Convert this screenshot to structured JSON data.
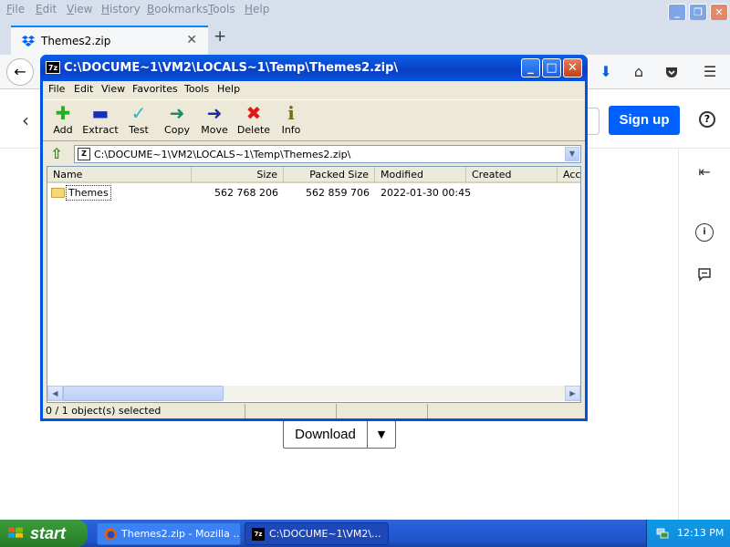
{
  "firefox": {
    "menu": [
      "File",
      "Edit",
      "View",
      "History",
      "Bookmarks",
      "Tools",
      "Help"
    ],
    "menu_accel": [
      "F",
      "E",
      "V",
      "H",
      "B",
      "T",
      "H"
    ],
    "menu_rest": [
      "ile",
      "dit",
      "iew",
      "istory",
      "ookmarks",
      "ools",
      "elp"
    ],
    "tab_title": "Themes2.zip",
    "tab_close": "✕",
    "new_tab": "+"
  },
  "dropbox": {
    "signup_label": "Sign up",
    "download_label": "Download",
    "accent": "#0061fe"
  },
  "zip": {
    "title": "C:\\DOCUME~1\\VM2\\LOCALS~1\\Temp\\Themes2.zip\\",
    "title_icon": "7z",
    "menu": [
      "File",
      "Edit",
      "View",
      "Favorites",
      "Tools",
      "Help"
    ],
    "toolbar": [
      {
        "label": "Add",
        "icon": "plus-icon"
      },
      {
        "label": "Extract",
        "icon": "minus-icon"
      },
      {
        "label": "Test",
        "icon": "check-icon"
      },
      {
        "label": "Copy",
        "icon": "copy-arrow-icon"
      },
      {
        "label": "Move",
        "icon": "move-arrow-icon"
      },
      {
        "label": "Delete",
        "icon": "delete-x-icon"
      },
      {
        "label": "Info",
        "icon": "info-icon"
      }
    ],
    "address": "C:\\DOCUME~1\\VM2\\LOCALS~1\\Temp\\Themes2.zip\\",
    "address_icon": "Z",
    "columns": [
      "Name",
      "Size",
      "Packed Size",
      "Modified",
      "Created",
      "Acce"
    ],
    "rows": [
      {
        "name": "Themes",
        "size": "562 768 206",
        "packed": "562 859 706",
        "modified": "2022-01-30 00:45",
        "created": "",
        "accessed": ""
      }
    ],
    "status": "0 / 1 object(s) selected"
  },
  "taskbar": {
    "start": "start",
    "tasks": [
      "Themes2.zip - Mozilla ...",
      "C:\\DOCUME~1\\VM2\\..."
    ],
    "task_7zip_icon": "7z",
    "clock": "12:13 PM"
  }
}
